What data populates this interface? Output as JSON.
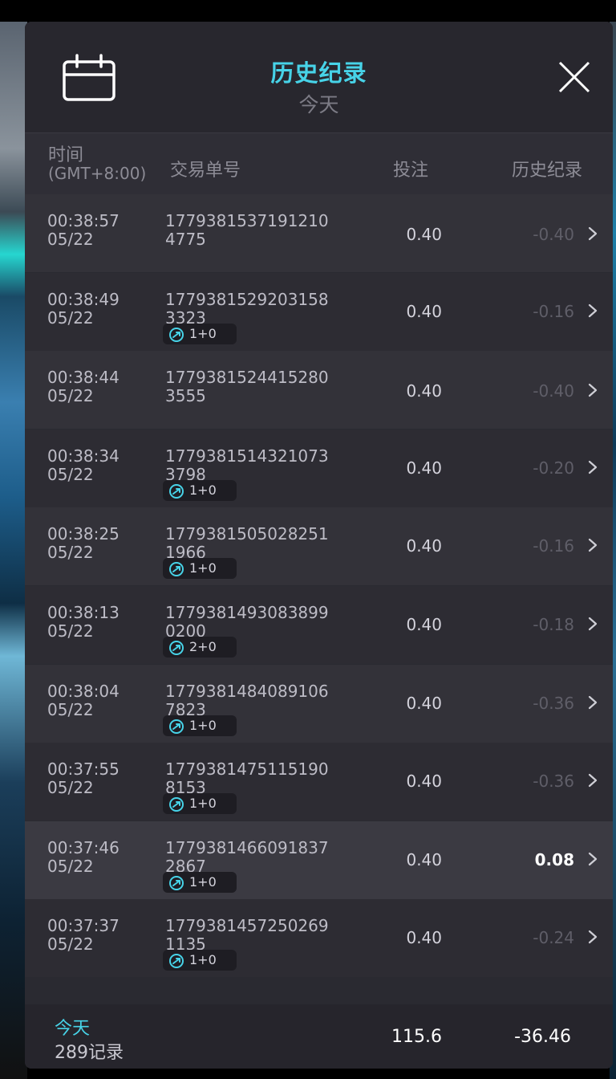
{
  "header": {
    "title": "历史纪录",
    "subtitle": "今天",
    "calendar_icon": "calendar-icon",
    "close_icon": "close-icon"
  },
  "columns": {
    "time": "时间",
    "timezone": "(GMT+8:00)",
    "order": "交易单号",
    "bet": "投注",
    "history": "历史纪录"
  },
  "colors": {
    "accent": "#47d3e8",
    "panel": "#2a2a31",
    "negative_text": "#5f5e68",
    "positive_text": "#ffffff"
  },
  "rows": [
    {
      "time": "00:38:57",
      "date": "05/22",
      "order_line1": "1779381537191210",
      "order_line2": "4775",
      "badge": "",
      "bet": "0.40",
      "result": "-0.40"
    },
    {
      "time": "00:38:49",
      "date": "05/22",
      "order_line1": "1779381529203158",
      "order_line2": "3323",
      "badge": "1+0",
      "bet": "0.40",
      "result": "-0.16"
    },
    {
      "time": "00:38:44",
      "date": "05/22",
      "order_line1": "1779381524415280",
      "order_line2": "3555",
      "badge": "",
      "bet": "0.40",
      "result": "-0.40"
    },
    {
      "time": "00:38:34",
      "date": "05/22",
      "order_line1": "1779381514321073",
      "order_line2": "3798",
      "badge": "1+0",
      "bet": "0.40",
      "result": "-0.20"
    },
    {
      "time": "00:38:25",
      "date": "05/22",
      "order_line1": "1779381505028251",
      "order_line2": "1966",
      "badge": "1+0",
      "bet": "0.40",
      "result": "-0.16"
    },
    {
      "time": "00:38:13",
      "date": "05/22",
      "order_line1": "1779381493083899",
      "order_line2": "0200",
      "badge": "2+0",
      "bet": "0.40",
      "result": "-0.18"
    },
    {
      "time": "00:38:04",
      "date": "05/22",
      "order_line1": "1779381484089106",
      "order_line2": "7823",
      "badge": "1+0",
      "bet": "0.40",
      "result": "-0.36"
    },
    {
      "time": "00:37:55",
      "date": "05/22",
      "order_line1": "1779381475115190",
      "order_line2": "8153",
      "badge": "1+0",
      "bet": "0.40",
      "result": "-0.36"
    },
    {
      "time": "00:37:46",
      "date": "05/22",
      "order_line1": "1779381466091837",
      "order_line2": "2867",
      "badge": "1+0",
      "bet": "0.40",
      "result": "0.08"
    },
    {
      "time": "00:37:37",
      "date": "05/22",
      "order_line1": "1779381457250269",
      "order_line2": "1135",
      "badge": "1+0",
      "bet": "0.40",
      "result": "-0.24"
    }
  ],
  "footer": {
    "label": "今天",
    "count": "289记录",
    "total_bet": "115.6",
    "total_result": "-36.46"
  }
}
